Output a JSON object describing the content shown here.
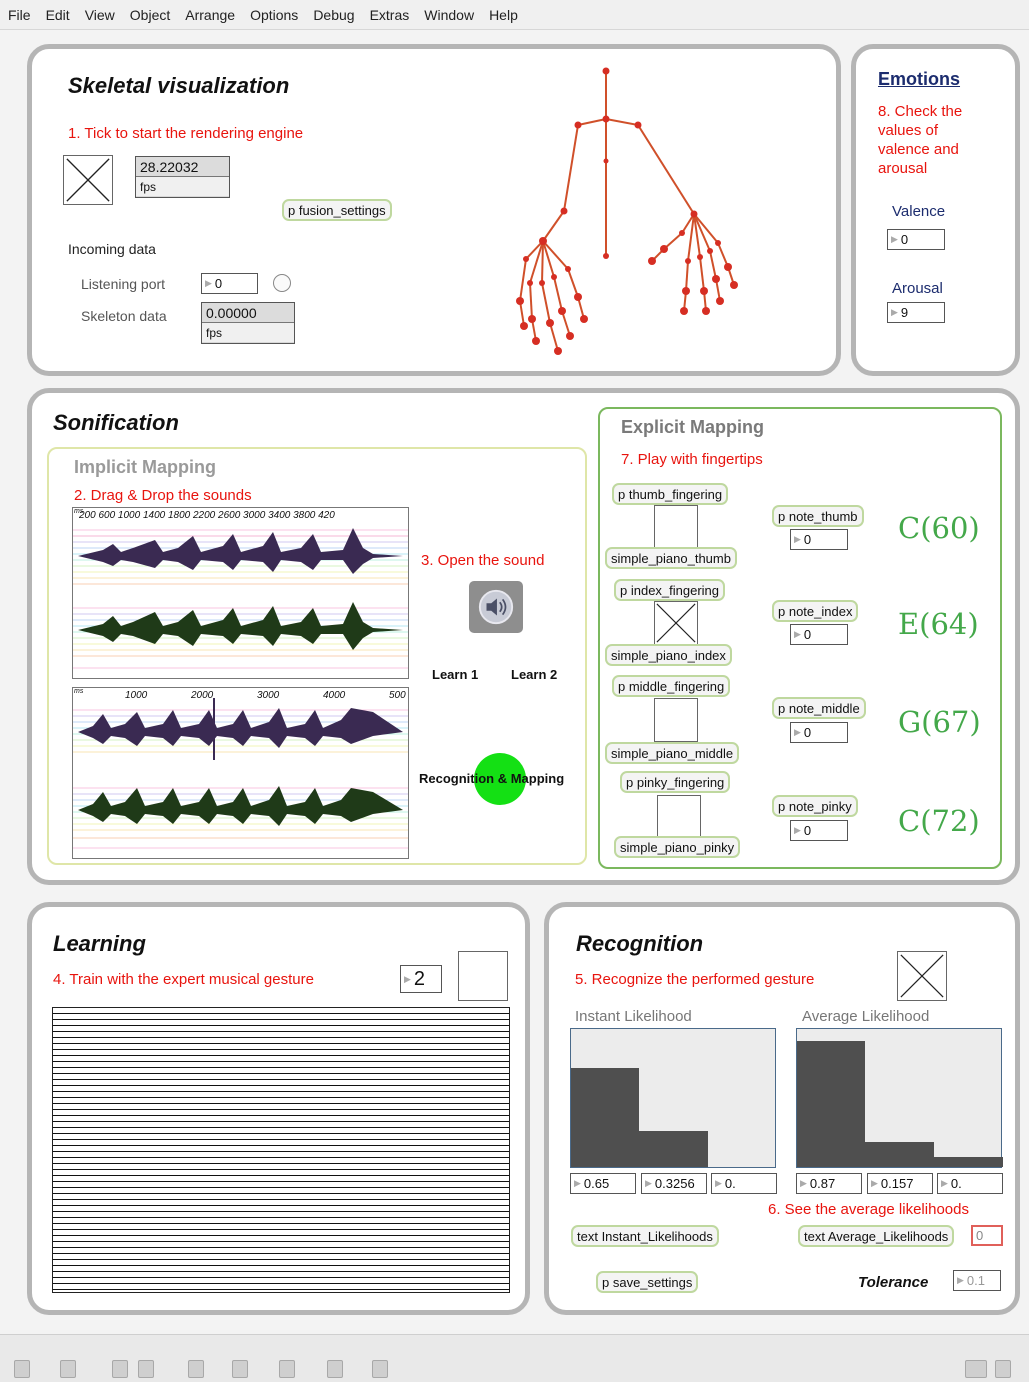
{
  "menu": [
    "File",
    "Edit",
    "View",
    "Object",
    "Arrange",
    "Options",
    "Debug",
    "Extras",
    "Window",
    "Help"
  ],
  "skeletal": {
    "title": "Skeletal visualization",
    "step1": "1. Tick to start the rendering engine",
    "fps_value": "28.22032",
    "fps_unit": "fps",
    "fusion_settings": "p fusion_settings",
    "incoming_data": "Incoming data",
    "listening_port_label": "Listening port",
    "listening_port_value": "0",
    "skeleton_data_label": "Skeleton data",
    "skeleton_value": "0.00000",
    "skeleton_unit": "fps"
  },
  "emotions": {
    "title": "Emotions",
    "step8": "8. Check the values of valence and arousal",
    "valence_label": "Valence",
    "valence_value": "0",
    "arousal_label": "Arousal",
    "arousal_value": "9"
  },
  "sonification": {
    "title": "Sonification",
    "implicit": {
      "title": "Implicit Mapping",
      "step2": "2. Drag & Drop the sounds",
      "wave1_axis": "200   600   1000 1400 1800 2200 2600 3000 3400 3800 420",
      "wave1_unit": "ms",
      "wave2_axis": [
        "1000",
        "2000",
        "3000",
        "4000",
        "500"
      ],
      "wave2_unit": "ms",
      "step3": "3. Open the sound",
      "learn1": "Learn 1",
      "learn2": "Learn 2",
      "recognition_mapping": "Recognition & Mapping",
      "led_color": "#14e014"
    },
    "explicit": {
      "title": "Explicit Mapping",
      "step7": "7. Play with fingertips",
      "fingers": [
        {
          "fingering": "p thumb_fingering",
          "piano": "simple_piano_thumb",
          "note_patch": "p note_thumb",
          "note_value": "0",
          "note": "C(60)",
          "checked": false
        },
        {
          "fingering": "p index_fingering",
          "piano": "simple_piano_index",
          "note_patch": "p note_index",
          "note_value": "0",
          "note": "E(64)",
          "checked": true
        },
        {
          "fingering": "p middle_fingering",
          "piano": "simple_piano_middle",
          "note_patch": "p note_middle",
          "note_value": "0",
          "note": "G(67)",
          "checked": false
        },
        {
          "fingering": "p pinky_fingering",
          "piano": "simple_piano_pinky",
          "note_patch": "p note_pinky",
          "note_value": "0",
          "note": "C(72)",
          "checked": false
        }
      ]
    }
  },
  "learning": {
    "title": "Learning",
    "step4": "4. Train with the expert musical gesture",
    "number": "2"
  },
  "recognition": {
    "title": "Recognition",
    "step5": "5. Recognize the performed gesture",
    "instant_label": "Instant Likelihood",
    "average_label": "Average Likelihood",
    "instant_values": [
      "0.65",
      "0.3256",
      "0."
    ],
    "average_values": [
      "0.87",
      "0.157",
      "0."
    ],
    "instant_bars": [
      0.72,
      0.26,
      0
    ],
    "average_bars": [
      0.91,
      0.18,
      0.07
    ],
    "step6": "6. See the average likelihoods",
    "text_instant": "text Instant_Likelihoods",
    "text_average": "text Average_Likelihoods",
    "avg_num": "0",
    "save_settings": "p save_settings",
    "tolerance_label": "Tolerance",
    "tolerance_value": "0.1"
  }
}
